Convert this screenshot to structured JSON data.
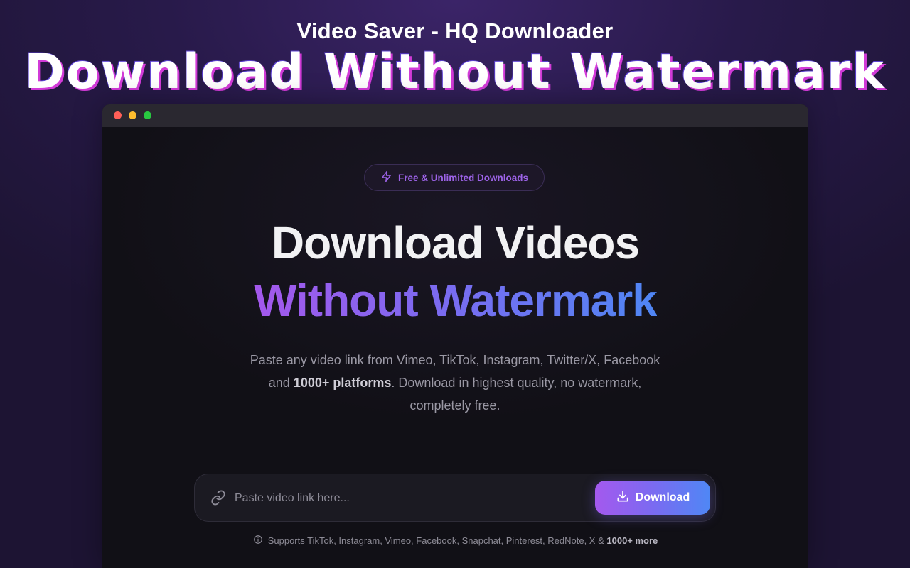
{
  "promo": {
    "subtitle": "Video Saver - HQ Downloader",
    "title": "Download Without Watermark"
  },
  "badge": {
    "icon": "lightning-icon",
    "label": "Free & Unlimited Downloads"
  },
  "hero": {
    "line1": "Download Videos",
    "line2": "Without Watermark"
  },
  "description": {
    "part1": "Paste any video link from Vimeo, TikTok, Instagram, Twitter/X, Facebook and ",
    "bold": "1000+ platforms",
    "part2": ". Download in highest quality, no watermark, completely free."
  },
  "search": {
    "icon": "link-icon",
    "placeholder": "Paste video link here...",
    "value": ""
  },
  "download_button": {
    "icon": "download-icon",
    "label": "Download"
  },
  "supports": {
    "icon": "info-icon",
    "text": "Supports TikTok, Instagram, Vimeo, Facebook, Snapchat, Pinterest, RedNote, X & ",
    "bold": "1000+ more"
  },
  "colors": {
    "accent_purple": "#a458ec",
    "accent_blue": "#4f86f4",
    "window_close": "#ff5f57",
    "window_minimize": "#febc2e",
    "window_maximize": "#28c840"
  }
}
